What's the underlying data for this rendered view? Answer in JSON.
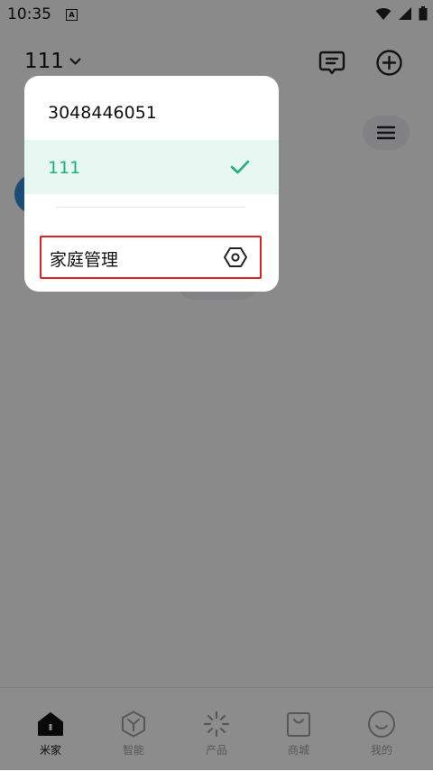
{
  "status_bar": {
    "time": "10:35",
    "a_icon_letter": "A",
    "icons": [
      "wifi-icon",
      "signal-icon",
      "battery-icon"
    ]
  },
  "header": {
    "home_name": "111",
    "icons": [
      "chevron-down-icon",
      "message-icon",
      "add-icon",
      "menu-icon"
    ]
  },
  "home_dropdown": {
    "homes": [
      {
        "name": "3048446051",
        "selected": false
      },
      {
        "name": "111",
        "selected": true
      }
    ],
    "manage_label": "家庭管理",
    "selected_color": "#1fad7f"
  },
  "tab_bar": {
    "tabs": [
      {
        "label": "米家",
        "icon": "home-icon",
        "active": true
      },
      {
        "label": "智能",
        "icon": "smart-cube-icon",
        "active": false
      },
      {
        "label": "产品",
        "icon": "product-spark-icon",
        "active": false
      },
      {
        "label": "商城",
        "icon": "shopping-bag-icon",
        "active": false
      },
      {
        "label": "我的",
        "icon": "smile-face-icon",
        "active": false
      }
    ]
  }
}
